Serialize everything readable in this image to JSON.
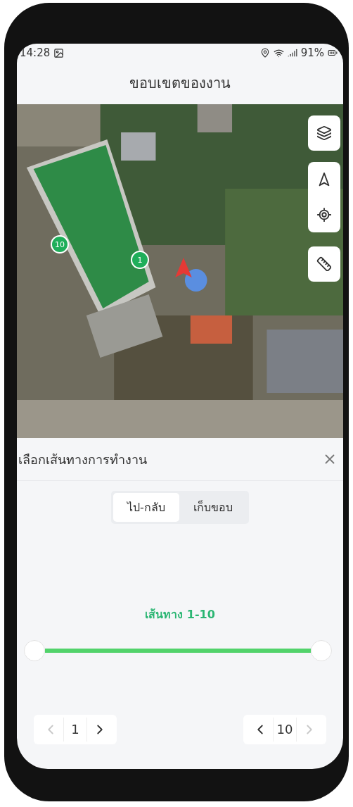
{
  "status_bar": {
    "time": "14:28",
    "battery": "91%"
  },
  "header": {
    "title": "ขอบเขตของงาน"
  },
  "map": {
    "kind": "picture",
    "markers": [
      {
        "label": "10"
      },
      {
        "label": "1"
      }
    ]
  },
  "sheet": {
    "title": "เลือกเส้นทางการทำงาน",
    "tabs": [
      {
        "label": "ไป-กลับ",
        "selected": true
      },
      {
        "label": "เก็บขอบ",
        "selected": false
      }
    ],
    "route_label": "เส้นทาง 1-10",
    "range": {
      "start": {
        "level": 0
      },
      "end": {
        "level": 1
      }
    },
    "steppers": [
      {
        "value": "1",
        "prev_disabled": true,
        "next_disabled": false
      },
      {
        "value": "10",
        "prev_disabled": false,
        "next_disabled": true
      }
    ]
  }
}
